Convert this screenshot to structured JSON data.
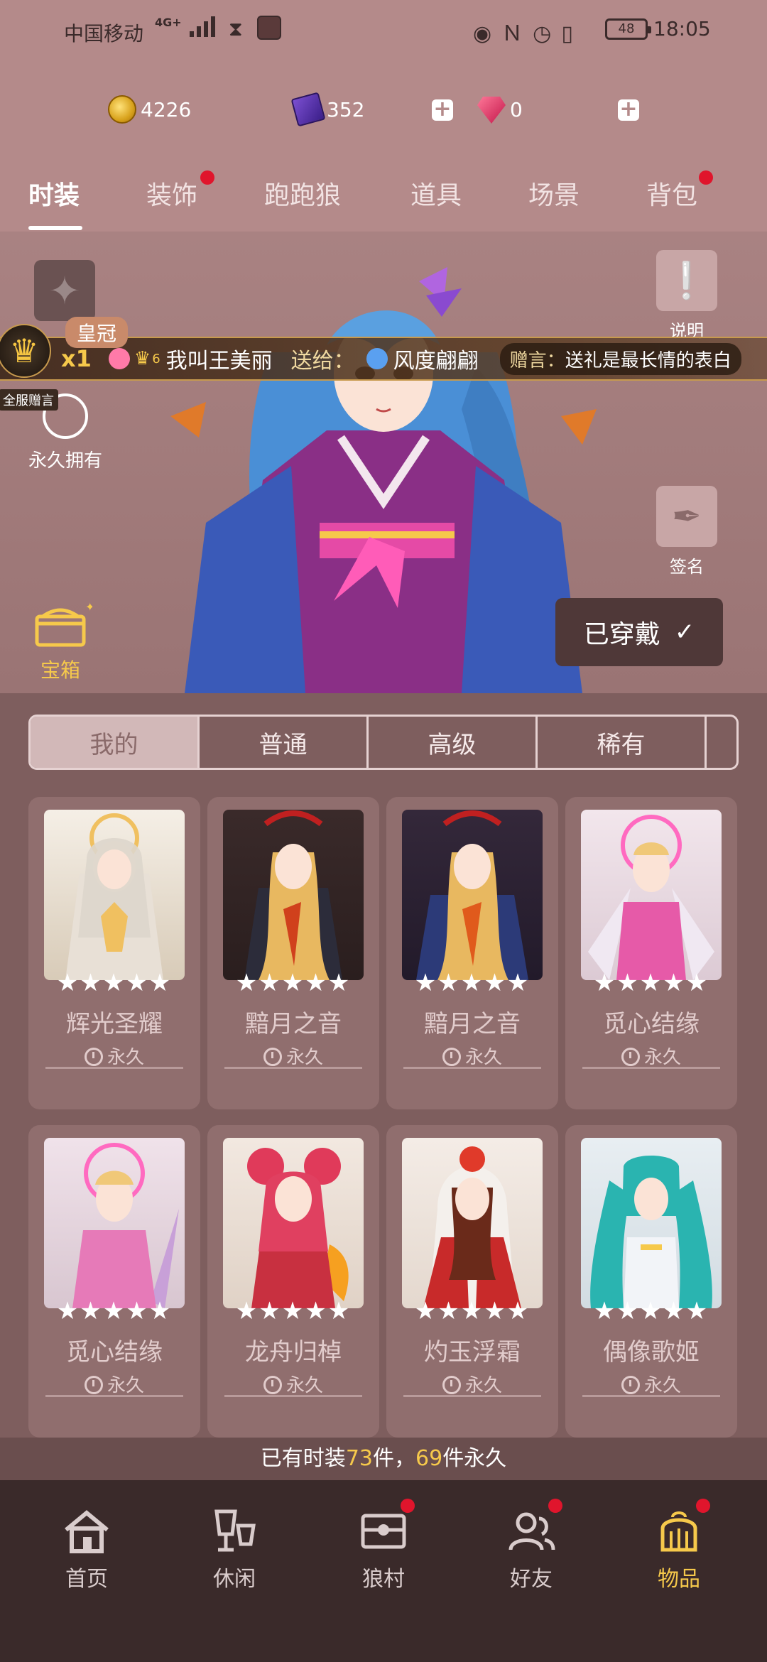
{
  "status_bar": {
    "carrier": "中国移动",
    "network": "4G+",
    "battery": "48",
    "time": "18:05"
  },
  "currencies": {
    "coins": "4226",
    "cards": "352",
    "gems": "0"
  },
  "top_tabs": [
    {
      "label": "时装",
      "active": true,
      "badge": false
    },
    {
      "label": "装饰",
      "active": false,
      "badge": true
    },
    {
      "label": "跑跑狼",
      "active": false,
      "badge": false
    },
    {
      "label": "道具",
      "active": false,
      "badge": false
    },
    {
      "label": "场景",
      "active": false,
      "badge": false
    },
    {
      "label": "背包",
      "active": false,
      "badge": true
    }
  ],
  "showcase": {
    "help_label": "说明",
    "sign_label": "签名",
    "permanent_label": "永久拥有",
    "treasure_label": "宝箱",
    "worn_label": "已穿戴",
    "crown_label": "皇冠",
    "all_server_tag": "全服赠言",
    "gift": {
      "multiplier": "x1",
      "sender": "我叫王美丽",
      "sender_level": "6",
      "give_label": "送给：",
      "receiver": "风度翩翩",
      "message_label": "赠言：",
      "message": "送礼是最长情的表白"
    }
  },
  "rarity_tabs": [
    {
      "label": "我的",
      "active": true
    },
    {
      "label": "普通",
      "active": false
    },
    {
      "label": "高级",
      "active": false
    },
    {
      "label": "稀有",
      "active": false
    }
  ],
  "outfits": [
    {
      "name": "辉光圣耀",
      "duration": "永久",
      "stars": "★★★★★"
    },
    {
      "name": "黯月之音",
      "duration": "永久",
      "stars": "★★★★★"
    },
    {
      "name": "黯月之音",
      "duration": "永久",
      "stars": "★★★★★"
    },
    {
      "name": "觅心结缘",
      "duration": "永久",
      "stars": "★★★★★"
    },
    {
      "name": "觅心结缘",
      "duration": "永久",
      "stars": "★★★★★"
    },
    {
      "name": "龙舟归棹",
      "duration": "永久",
      "stars": "★★★★★"
    },
    {
      "name": "灼玉浮霜",
      "duration": "永久",
      "stars": "★★★★★"
    },
    {
      "name": "偶像歌姬",
      "duration": "永久",
      "stars": "★★★★★"
    }
  ],
  "summary": {
    "prefix": "已有时装",
    "total": "73",
    "middle": "件，",
    "permanent": "69",
    "suffix": "件永久"
  },
  "bottom_nav": [
    {
      "label": "首页",
      "icon": "home-icon",
      "active": false,
      "badge": false
    },
    {
      "label": "休闲",
      "icon": "leisure-icon",
      "active": false,
      "badge": false
    },
    {
      "label": "狼村",
      "icon": "wolf-village-icon",
      "active": false,
      "badge": true
    },
    {
      "label": "好友",
      "icon": "friends-icon",
      "active": false,
      "badge": true
    },
    {
      "label": "物品",
      "icon": "items-icon",
      "active": true,
      "badge": true
    }
  ],
  "colors": {
    "header_bg": "#b48a8a",
    "accent_gold": "#f6c94b",
    "badge_red": "#e0152c",
    "nav_bg": "#3a2a2a"
  }
}
